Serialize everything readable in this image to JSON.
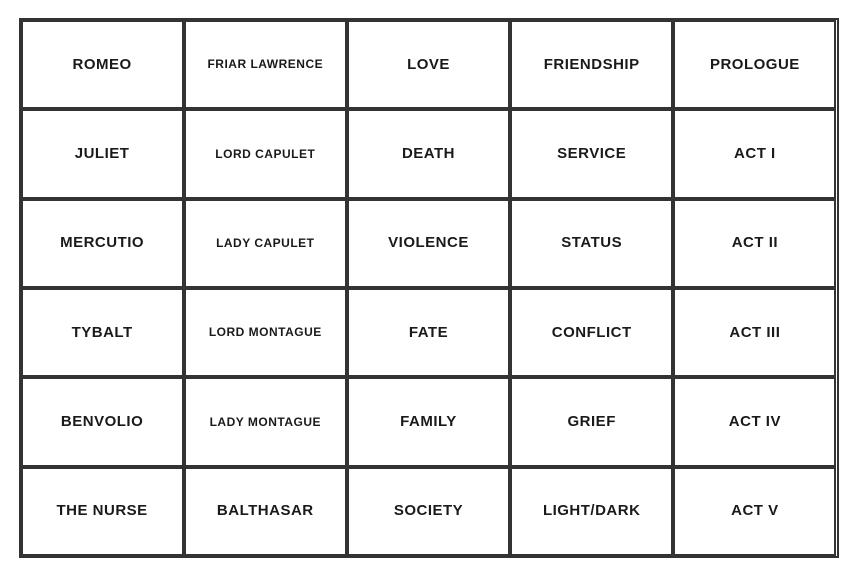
{
  "grid": {
    "cells": [
      {
        "id": "romeo",
        "text": "ROMEO",
        "small": false
      },
      {
        "id": "friar-lawrence",
        "text": "FRIAR LAWRENCE",
        "small": true
      },
      {
        "id": "love",
        "text": "LOVE",
        "small": false
      },
      {
        "id": "friendship",
        "text": "FRIENDSHIP",
        "small": false
      },
      {
        "id": "prologue",
        "text": "PROLOGUE",
        "small": false
      },
      {
        "id": "juliet",
        "text": "JULIET",
        "small": false
      },
      {
        "id": "lord-capulet",
        "text": "LORD CAPULET",
        "small": true
      },
      {
        "id": "death",
        "text": "DEATH",
        "small": false
      },
      {
        "id": "service",
        "text": "SERVICE",
        "small": false
      },
      {
        "id": "act-i",
        "text": "ACT I",
        "small": false
      },
      {
        "id": "mercutio",
        "text": "MERCUTIO",
        "small": false
      },
      {
        "id": "lady-capulet",
        "text": "LADY CAPULET",
        "small": true
      },
      {
        "id": "violence",
        "text": "VIOLENCE",
        "small": false
      },
      {
        "id": "status",
        "text": "STATUS",
        "small": false
      },
      {
        "id": "act-ii",
        "text": "ACT II",
        "small": false
      },
      {
        "id": "tybalt",
        "text": "TYBALT",
        "small": false
      },
      {
        "id": "lord-montague",
        "text": "LORD MONTAGUE",
        "small": true
      },
      {
        "id": "fate",
        "text": "FATE",
        "small": false
      },
      {
        "id": "conflict",
        "text": "CONFLICT",
        "small": false
      },
      {
        "id": "act-iii",
        "text": "ACT III",
        "small": false
      },
      {
        "id": "benvolio",
        "text": "BENVOLIO",
        "small": false
      },
      {
        "id": "lady-montague",
        "text": "LADY MONTAGUE",
        "small": true
      },
      {
        "id": "family",
        "text": "FAMILY",
        "small": false
      },
      {
        "id": "grief",
        "text": "GRIEF",
        "small": false
      },
      {
        "id": "act-iv",
        "text": "ACT IV",
        "small": false
      },
      {
        "id": "the-nurse",
        "text": "THE NURSE",
        "small": false
      },
      {
        "id": "balthasar",
        "text": "BALTHASAR",
        "small": false
      },
      {
        "id": "society",
        "text": "SOCIETY",
        "small": false
      },
      {
        "id": "light-dark",
        "text": "LIGHT/DARK",
        "small": false
      },
      {
        "id": "act-v",
        "text": "ACT V",
        "small": false
      }
    ]
  }
}
